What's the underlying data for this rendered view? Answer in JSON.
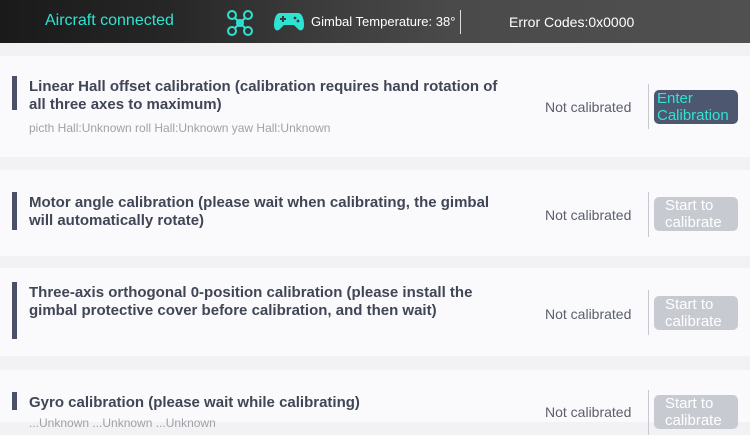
{
  "header": {
    "connection_status": "Aircraft connected",
    "gimbal_temperature": "Gimbal Temperature: 38°",
    "error_codes": "Error Codes:0x0000",
    "icons": [
      "drone-icon",
      "gamepad-icon"
    ],
    "accent_color": "#2fe3d3"
  },
  "items": [
    {
      "title": "Linear Hall offset calibration (calibration requires hand rotation of all three axes to maximum)",
      "detail": "picth Hall:Unknown roll Hall:Unknown yaw Hall:Unknown",
      "status": "Not calibrated",
      "button": "Enter Calibration"
    },
    {
      "title": "Motor angle calibration (please wait when calibrating, the gimbal will automatically rotate)",
      "status": "Not calibrated",
      "button": "Start to calibrate"
    },
    {
      "title": "Three-axis orthogonal 0-position calibration (please install the gimbal protective cover before calibration, and then wait)",
      "status": "Not calibrated",
      "button": "Start to calibrate"
    },
    {
      "title": "Gyro calibration (please wait while calibrating)",
      "detail": "...Unknown ...Unknown ...Unknown",
      "status": "Not calibrated",
      "button": "Start to calibrate"
    }
  ]
}
